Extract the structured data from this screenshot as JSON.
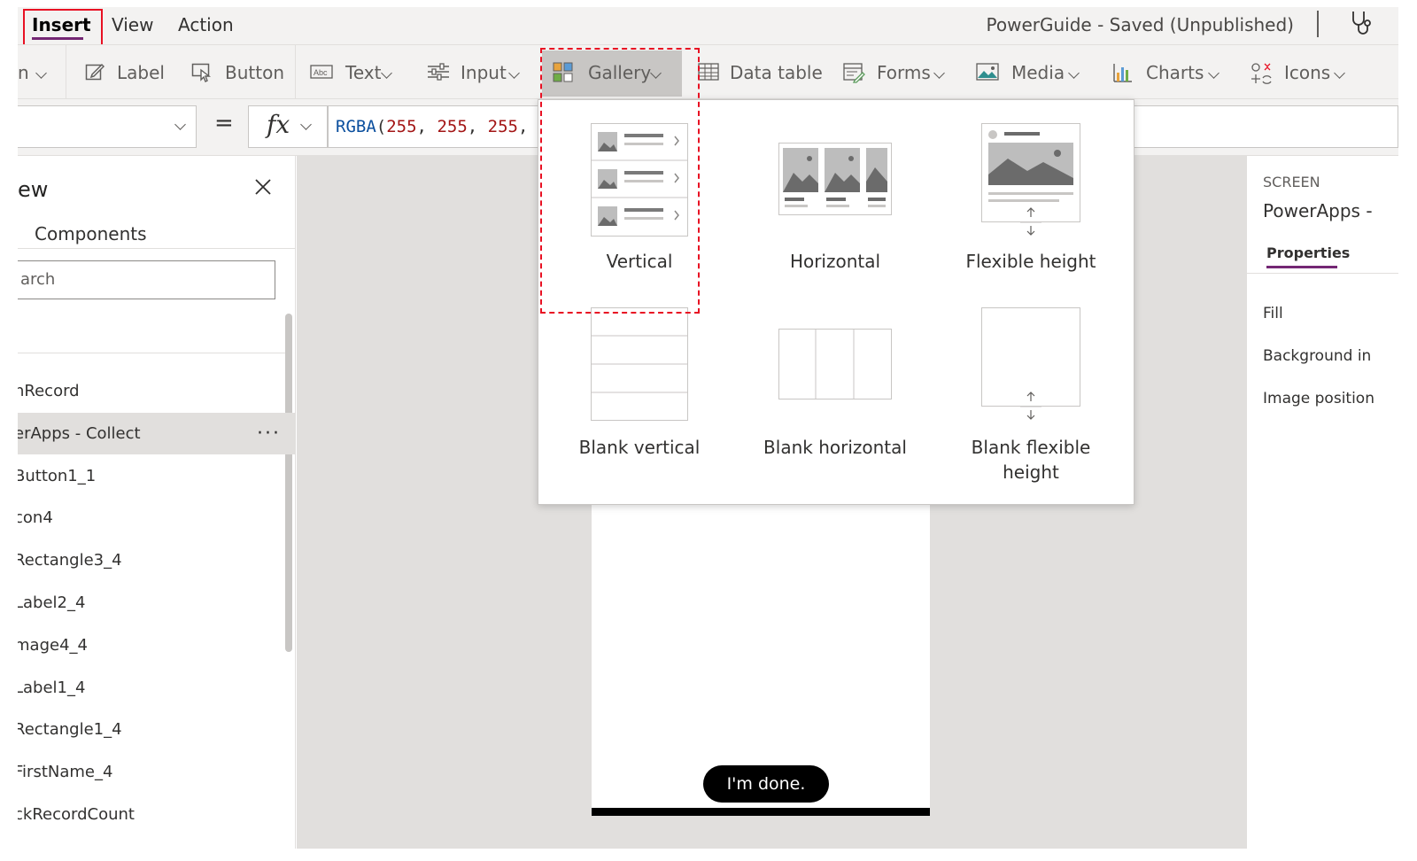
{
  "menu": {
    "tabs": [
      {
        "label": "Insert"
      },
      {
        "label": "View"
      },
      {
        "label": "Action"
      }
    ],
    "app_title": "PowerGuide - Saved (Unpublished)"
  },
  "ribbon": {
    "screen_partial": "n",
    "label": "Label",
    "button": "Button",
    "text": "Text",
    "input": "Input",
    "gallery": "Gallery",
    "data_table": "Data table",
    "forms": "Forms",
    "media": "Media",
    "charts": "Charts",
    "icons": "Icons"
  },
  "formula": {
    "equals": "=",
    "fx": "fx",
    "fn": "RGBA",
    "args": [
      "255",
      "255",
      "255"
    ]
  },
  "tree": {
    "title": "ew",
    "tab": "Components",
    "search_placeholder": "arch",
    "items": [
      {
        "label": "hRecord"
      },
      {
        "label": "erApps - Collect",
        "selected": true,
        "more": "···"
      },
      {
        "label": "Button1_1"
      },
      {
        "label": "con4"
      },
      {
        "label": "Rectangle3_4"
      },
      {
        "label": "Label2_4"
      },
      {
        "label": "mage4_4"
      },
      {
        "label": "Label1_4"
      },
      {
        "label": "Rectangle1_4"
      },
      {
        "label": "FirstName_4"
      },
      {
        "label": "ckRecordCount"
      }
    ]
  },
  "canvas": {
    "done_button": "I'm done."
  },
  "properties": {
    "kind": "SCREEN",
    "name": "PowerApps -",
    "tab": "Properties",
    "rows": [
      "Fill",
      "Background in",
      "Image position"
    ]
  },
  "gallery_menu": {
    "options": [
      {
        "label": "Vertical"
      },
      {
        "label": "Horizontal"
      },
      {
        "label": "Flexible height"
      },
      {
        "label": "Blank vertical"
      },
      {
        "label": "Blank horizontal"
      },
      {
        "label": "Blank flexible height"
      }
    ]
  },
  "colors": {
    "accent": "#742774",
    "highlight": "#e81123"
  }
}
